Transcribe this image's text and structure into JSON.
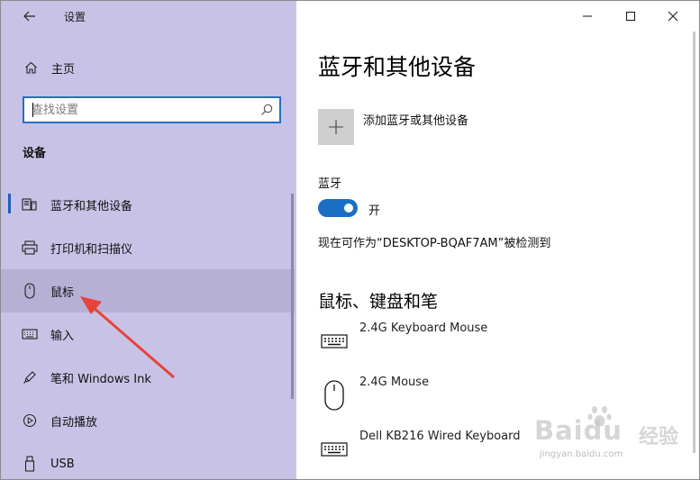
{
  "window": {
    "title": "设置"
  },
  "sidebar": {
    "home_label": "主页",
    "search_placeholder": "查找设置",
    "section_heading": "设备",
    "items": [
      {
        "label": "蓝牙和其他设备",
        "icon": "bluetooth-devices-icon",
        "active": true
      },
      {
        "label": "打印机和扫描仪",
        "icon": "printer-icon"
      },
      {
        "label": "鼠标",
        "icon": "mouse-icon",
        "hovered": true
      },
      {
        "label": "输入",
        "icon": "keyboard-icon"
      },
      {
        "label": "笔和 Windows Ink",
        "icon": "pen-icon"
      },
      {
        "label": "自动播放",
        "icon": "autoplay-icon"
      },
      {
        "label": "USB",
        "icon": "usb-icon"
      }
    ]
  },
  "content": {
    "page_title": "蓝牙和其他设备",
    "add_device_label": "添加蓝牙或其他设备",
    "bluetooth_label": "蓝牙",
    "toggle_state_label": "开",
    "discoverable_text": "现在可作为“DESKTOP-BQAF7AM”被检测到",
    "devices_section_title": "鼠标、键盘和笔",
    "devices": [
      {
        "label": "2.4G Keyboard Mouse",
        "icon": "keyboard-icon"
      },
      {
        "label": "2.4G Mouse",
        "icon": "mouse-icon"
      },
      {
        "label": "Dell KB216 Wired Keyboard",
        "icon": "keyboard-icon"
      }
    ]
  },
  "watermark": {
    "brand": "Baidu",
    "jingyan": "经验",
    "url": "jingyan.baidu.com"
  },
  "colors": {
    "sidebar_bg": "#c8c3e6",
    "accent": "#1a6fc4",
    "hover_bg": "#b5b0d4",
    "annotation_arrow": "#e8423a"
  }
}
